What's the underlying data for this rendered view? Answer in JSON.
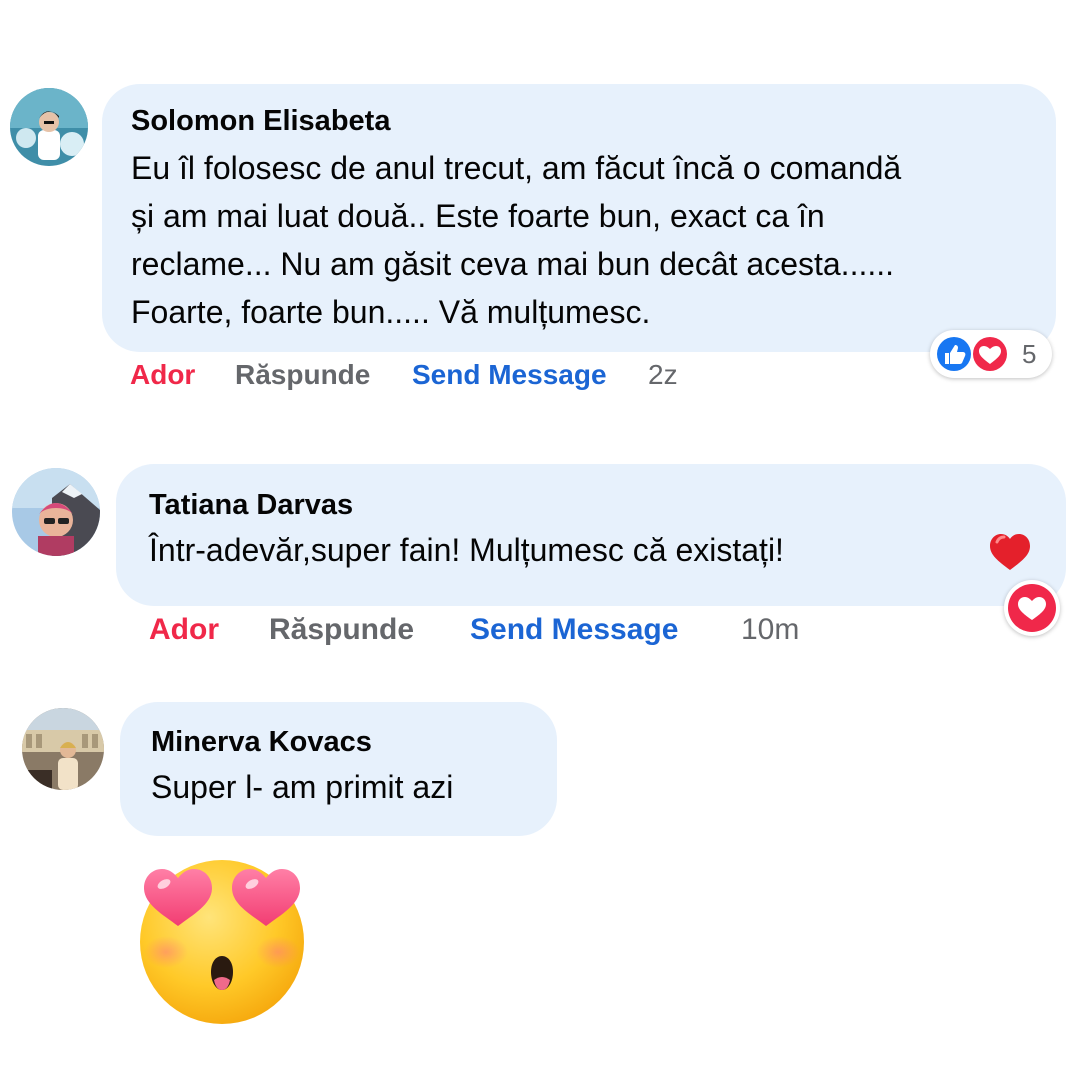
{
  "comments": [
    {
      "author": "Solomon Elisabeta",
      "lines": [
        "Eu îl folosesc de anul trecut, am făcut încă o comandă",
        "și am mai luat două.. Este foarte bun, exact ca în",
        "reclame... Nu am găsit ceva mai bun decât acesta......",
        "Foarte, foarte bun..... Vă mulțumesc."
      ],
      "actions": {
        "like": "Ador",
        "reply": "Răspunde",
        "send": "Send Message",
        "time": "2z"
      },
      "reactions": {
        "icons": [
          "like-icon",
          "love-icon"
        ],
        "count": "5"
      }
    },
    {
      "author": "Tatiana Darvas",
      "text": "Într-adevăr,super fain! Mulțumesc că existați!",
      "actions": {
        "like": "Ador",
        "reply": "Răspunde",
        "send": "Send Message",
        "time": "10m"
      },
      "reactions": {
        "icons": [
          "love-icon"
        ]
      }
    },
    {
      "author": "Minerva Kovacs",
      "text": "Super l- am primit azi",
      "sticker": "heart-eyes-emoji-icon"
    }
  ],
  "colors": {
    "bubble": "#e7f1fc",
    "ador": "#f02849",
    "reply": "#65676b",
    "send": "#1b65d4",
    "like_blue": "#1877f2",
    "love_red": "#f0284a"
  }
}
